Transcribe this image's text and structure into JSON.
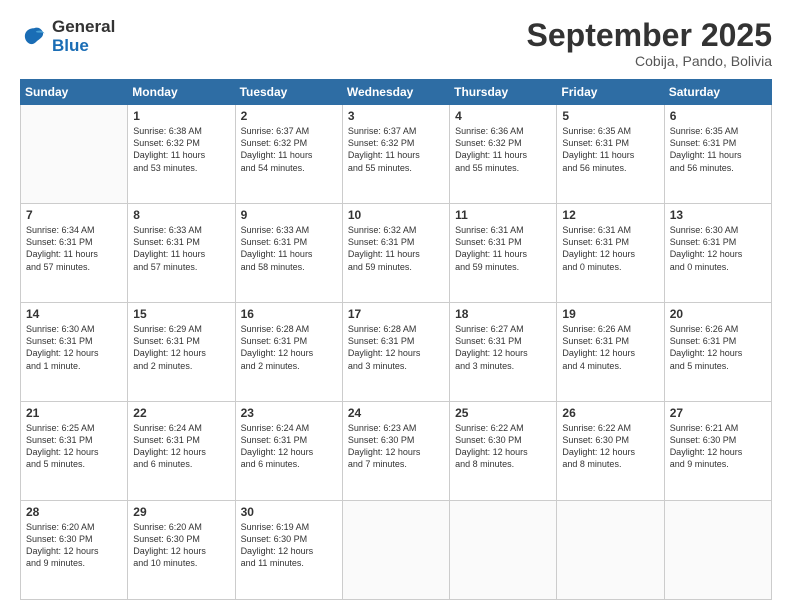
{
  "logo": {
    "line1": "General",
    "line2": "Blue"
  },
  "header": {
    "month": "September 2025",
    "location": "Cobija, Pando, Bolivia"
  },
  "weekdays": [
    "Sunday",
    "Monday",
    "Tuesday",
    "Wednesday",
    "Thursday",
    "Friday",
    "Saturday"
  ],
  "weeks": [
    [
      {
        "day": "",
        "info": ""
      },
      {
        "day": "1",
        "info": "Sunrise: 6:38 AM\nSunset: 6:32 PM\nDaylight: 11 hours\nand 53 minutes."
      },
      {
        "day": "2",
        "info": "Sunrise: 6:37 AM\nSunset: 6:32 PM\nDaylight: 11 hours\nand 54 minutes."
      },
      {
        "day": "3",
        "info": "Sunrise: 6:37 AM\nSunset: 6:32 PM\nDaylight: 11 hours\nand 55 minutes."
      },
      {
        "day": "4",
        "info": "Sunrise: 6:36 AM\nSunset: 6:32 PM\nDaylight: 11 hours\nand 55 minutes."
      },
      {
        "day": "5",
        "info": "Sunrise: 6:35 AM\nSunset: 6:31 PM\nDaylight: 11 hours\nand 56 minutes."
      },
      {
        "day": "6",
        "info": "Sunrise: 6:35 AM\nSunset: 6:31 PM\nDaylight: 11 hours\nand 56 minutes."
      }
    ],
    [
      {
        "day": "7",
        "info": "Sunrise: 6:34 AM\nSunset: 6:31 PM\nDaylight: 11 hours\nand 57 minutes."
      },
      {
        "day": "8",
        "info": "Sunrise: 6:33 AM\nSunset: 6:31 PM\nDaylight: 11 hours\nand 57 minutes."
      },
      {
        "day": "9",
        "info": "Sunrise: 6:33 AM\nSunset: 6:31 PM\nDaylight: 11 hours\nand 58 minutes."
      },
      {
        "day": "10",
        "info": "Sunrise: 6:32 AM\nSunset: 6:31 PM\nDaylight: 11 hours\nand 59 minutes."
      },
      {
        "day": "11",
        "info": "Sunrise: 6:31 AM\nSunset: 6:31 PM\nDaylight: 11 hours\nand 59 minutes."
      },
      {
        "day": "12",
        "info": "Sunrise: 6:31 AM\nSunset: 6:31 PM\nDaylight: 12 hours\nand 0 minutes."
      },
      {
        "day": "13",
        "info": "Sunrise: 6:30 AM\nSunset: 6:31 PM\nDaylight: 12 hours\nand 0 minutes."
      }
    ],
    [
      {
        "day": "14",
        "info": "Sunrise: 6:30 AM\nSunset: 6:31 PM\nDaylight: 12 hours\nand 1 minute."
      },
      {
        "day": "15",
        "info": "Sunrise: 6:29 AM\nSunset: 6:31 PM\nDaylight: 12 hours\nand 2 minutes."
      },
      {
        "day": "16",
        "info": "Sunrise: 6:28 AM\nSunset: 6:31 PM\nDaylight: 12 hours\nand 2 minutes."
      },
      {
        "day": "17",
        "info": "Sunrise: 6:28 AM\nSunset: 6:31 PM\nDaylight: 12 hours\nand 3 minutes."
      },
      {
        "day": "18",
        "info": "Sunrise: 6:27 AM\nSunset: 6:31 PM\nDaylight: 12 hours\nand 3 minutes."
      },
      {
        "day": "19",
        "info": "Sunrise: 6:26 AM\nSunset: 6:31 PM\nDaylight: 12 hours\nand 4 minutes."
      },
      {
        "day": "20",
        "info": "Sunrise: 6:26 AM\nSunset: 6:31 PM\nDaylight: 12 hours\nand 5 minutes."
      }
    ],
    [
      {
        "day": "21",
        "info": "Sunrise: 6:25 AM\nSunset: 6:31 PM\nDaylight: 12 hours\nand 5 minutes."
      },
      {
        "day": "22",
        "info": "Sunrise: 6:24 AM\nSunset: 6:31 PM\nDaylight: 12 hours\nand 6 minutes."
      },
      {
        "day": "23",
        "info": "Sunrise: 6:24 AM\nSunset: 6:31 PM\nDaylight: 12 hours\nand 6 minutes."
      },
      {
        "day": "24",
        "info": "Sunrise: 6:23 AM\nSunset: 6:30 PM\nDaylight: 12 hours\nand 7 minutes."
      },
      {
        "day": "25",
        "info": "Sunrise: 6:22 AM\nSunset: 6:30 PM\nDaylight: 12 hours\nand 8 minutes."
      },
      {
        "day": "26",
        "info": "Sunrise: 6:22 AM\nSunset: 6:30 PM\nDaylight: 12 hours\nand 8 minutes."
      },
      {
        "day": "27",
        "info": "Sunrise: 6:21 AM\nSunset: 6:30 PM\nDaylight: 12 hours\nand 9 minutes."
      }
    ],
    [
      {
        "day": "28",
        "info": "Sunrise: 6:20 AM\nSunset: 6:30 PM\nDaylight: 12 hours\nand 9 minutes."
      },
      {
        "day": "29",
        "info": "Sunrise: 6:20 AM\nSunset: 6:30 PM\nDaylight: 12 hours\nand 10 minutes."
      },
      {
        "day": "30",
        "info": "Sunrise: 6:19 AM\nSunset: 6:30 PM\nDaylight: 12 hours\nand 11 minutes."
      },
      {
        "day": "",
        "info": ""
      },
      {
        "day": "",
        "info": ""
      },
      {
        "day": "",
        "info": ""
      },
      {
        "day": "",
        "info": ""
      }
    ]
  ]
}
